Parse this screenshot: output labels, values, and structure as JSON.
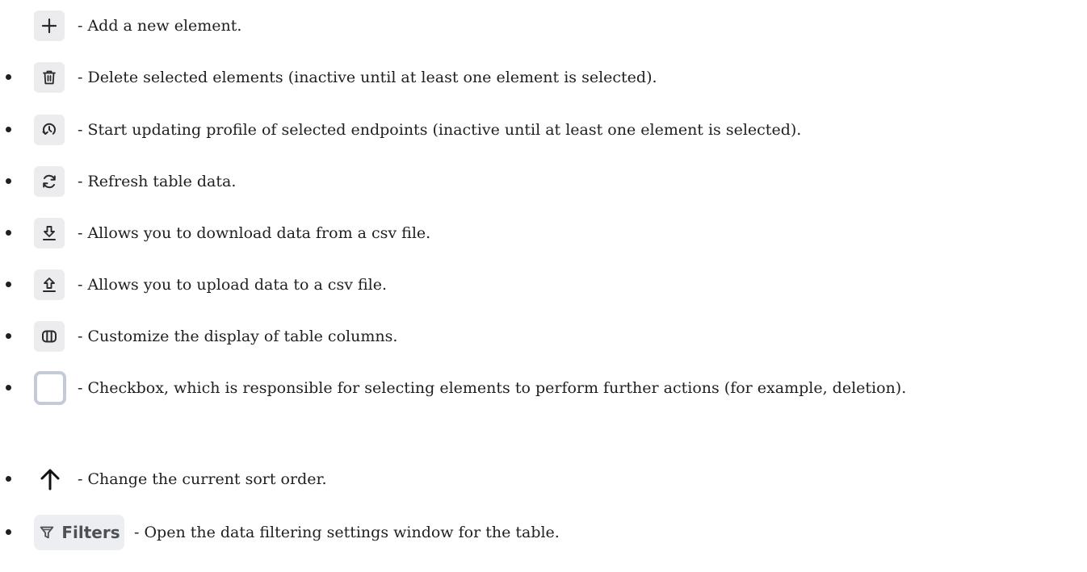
{
  "items": [
    {
      "icon": "plus-icon",
      "bullet": false,
      "text": "- Add a new element."
    },
    {
      "icon": "trash-icon",
      "bullet": true,
      "text": "- Delete selected elements (inactive until at least one element is selected)."
    },
    {
      "icon": "update-profile-icon",
      "bullet": true,
      "text": "- Start updating profile of selected endpoints (inactive until at least one element is selected)."
    },
    {
      "icon": "refresh-icon",
      "bullet": true,
      "text": "- Refresh table data."
    },
    {
      "icon": "download-icon",
      "bullet": true,
      "text": "- Allows you to download data from a csv file."
    },
    {
      "icon": "upload-icon",
      "bullet": true,
      "text": "- Allows you to upload data to a csv file."
    },
    {
      "icon": "columns-icon",
      "bullet": true,
      "text": "- Customize the display of table columns."
    },
    {
      "icon": "checkbox",
      "bullet": true,
      "text": "- Checkbox, which is responsible for selecting elements to perform further actions (for example, deletion)."
    },
    {
      "icon": "arrow-up-icon",
      "bullet": true,
      "text": "- Change the current sort order."
    },
    {
      "icon": "filter-icon",
      "bullet": true,
      "label": "Filters",
      "text": "- Open the data filtering settings window for the table."
    }
  ]
}
